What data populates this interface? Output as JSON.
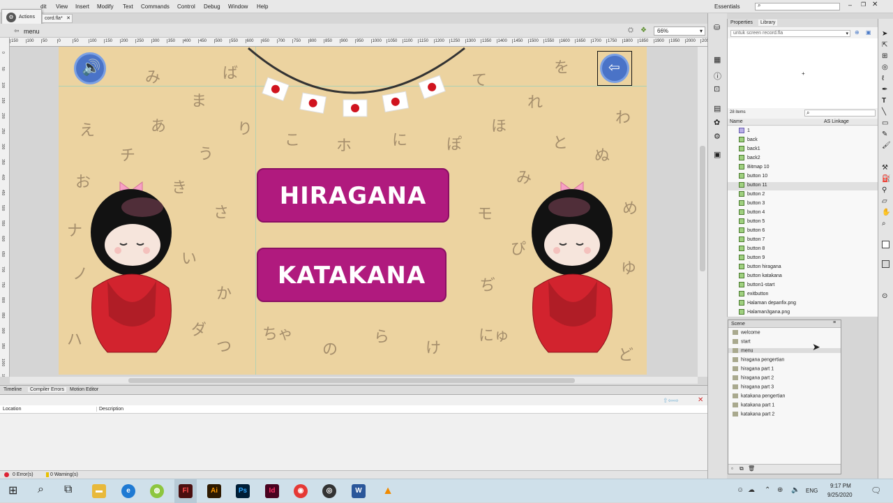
{
  "menubar": {
    "items": [
      "dit",
      "View",
      "Insert",
      "Modify",
      "Text",
      "Commands",
      "Control",
      "Debug",
      "Window",
      "Help"
    ],
    "workspace": "Essentials"
  },
  "actions_panel": {
    "label": "Actions"
  },
  "document": {
    "tab": "cord.fla*",
    "scene": "menu",
    "zoom": "66%"
  },
  "ruler": {
    "top_marks": [
      "150",
      "100",
      "50",
      "0",
      "50",
      "100",
      "150",
      "200",
      "250",
      "300",
      "350",
      "400",
      "450",
      "500",
      "550",
      "600",
      "650",
      "700",
      "750",
      "800",
      "850",
      "900",
      "950",
      "1000",
      "1050",
      "1100",
      "1150",
      "1200",
      "1250",
      "1300",
      "1350",
      "1400",
      "1450",
      "1500",
      "1550",
      "1600",
      "1650",
      "1700",
      "1750",
      "1800",
      "1850",
      "1900",
      "1950",
      "2000",
      "2050"
    ],
    "left_marks": [
      "0",
      "50",
      "100",
      "150",
      "200",
      "250",
      "300",
      "350",
      "400",
      "450",
      "500",
      "550",
      "600",
      "650",
      "700",
      "750",
      "800",
      "850",
      "900",
      "950",
      "1000",
      "1050"
    ]
  },
  "stage": {
    "buttons": {
      "hiragana": "HIRAGANA",
      "katakana": "KATAKANA"
    },
    "kana": [
      "み",
      "ば",
      "ま",
      "て",
      "を",
      "れ",
      "わ",
      "え",
      "あ",
      "り",
      "こ",
      "ホ",
      "に",
      "ぽ",
      "ほ",
      "と",
      "ぬ",
      "チ",
      "う",
      "お",
      "き",
      "さ",
      "み",
      "モ",
      "ナ",
      "い",
      "ぴ",
      "め",
      "ノ",
      "か",
      "ぢ",
      "ゆ",
      "ハ",
      "ダ",
      "つ",
      "ちゃ",
      "の",
      "ら",
      "け",
      "にゅ",
      "ど"
    ],
    "colors": {
      "background": "#ecd3a0",
      "button": "#b01a7e",
      "sound_button": "#4a73c7"
    }
  },
  "bottom_panel": {
    "tabs": [
      "Timeline",
      "Compiler Errors",
      "Motion Editor"
    ],
    "columns": [
      "Location",
      "Description"
    ],
    "errors": "0 Error(s)",
    "warnings": "0 Warning(s)"
  },
  "properties": {
    "tabs": [
      "Properties",
      "Library"
    ],
    "file": "untuk screen record.fla",
    "item_count": "28 items",
    "columns": [
      "Name",
      "AS Linkage"
    ],
    "items": [
      "1",
      "back",
      "back1",
      "back2",
      "Bitmap 10",
      "button 10",
      "button 11",
      "button 2",
      "button 3",
      "button 4",
      "button 5",
      "button 6",
      "button 7",
      "button 8",
      "button 9",
      "button hiragana",
      "button katakana",
      "button1-start",
      "exitbutton",
      "Halaman depanfix.png",
      "Halaman3gana.png"
    ]
  },
  "scene_panel": {
    "title": "Scene",
    "scenes": [
      "welcome",
      "start",
      "menu",
      "hiragana pengertian",
      "hiragana part 1",
      "hiragana part 2",
      "hiragana part 3",
      "katakana pengertian",
      "katakana part 1",
      "katakana part 2"
    ]
  },
  "taskbar": {
    "time": "9:17 PM",
    "date": "9/25/2020",
    "lang": "ENG",
    "apps": [
      "Fl",
      "Ai",
      "Ps",
      "Id"
    ]
  }
}
